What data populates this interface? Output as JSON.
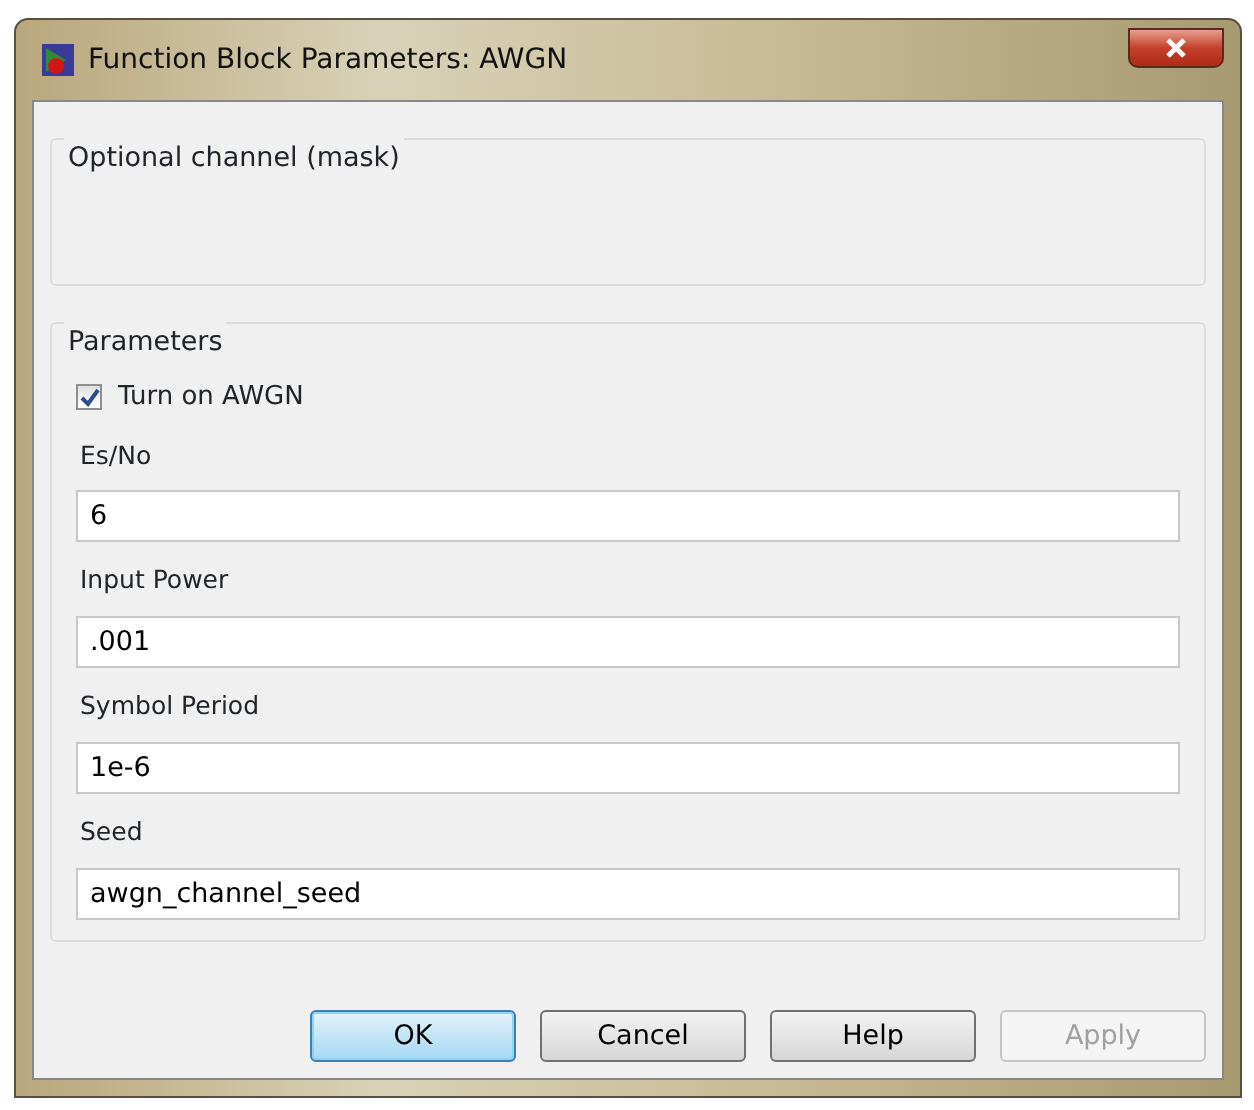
{
  "window": {
    "title": "Function Block Parameters: AWGN"
  },
  "groups": [
    {
      "title": "Optional channel (mask)"
    },
    {
      "title": "Parameters",
      "items": [
        {
          "kind": "checkbox",
          "label": "Turn on AWGN",
          "checked": true
        },
        {
          "kind": "field",
          "label": "Es/No",
          "value": "6"
        },
        {
          "kind": "field",
          "label": "Input Power",
          "value": ".001"
        },
        {
          "kind": "field",
          "label": "Symbol Period",
          "value": "1e-6"
        },
        {
          "kind": "field",
          "label": "Seed",
          "value": "awgn_channel_seed"
        }
      ]
    }
  ],
  "buttons": [
    {
      "label": "OK",
      "default": true,
      "disabled": false
    },
    {
      "label": "Cancel",
      "default": false,
      "disabled": false
    },
    {
      "label": "Help",
      "default": false,
      "disabled": false
    },
    {
      "label": "Apply",
      "default": false,
      "disabled": true
    }
  ]
}
